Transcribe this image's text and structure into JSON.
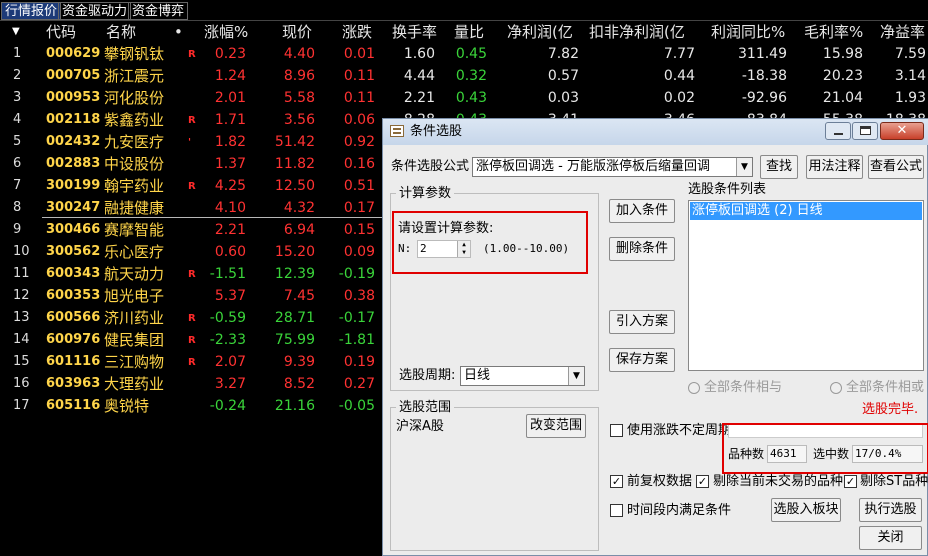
{
  "tabs": [
    "行情报价",
    "资金驱动力",
    "资金博弈"
  ],
  "table": {
    "headers": [
      "代码",
      "名称",
      "•",
      "涨幅%",
      "现价",
      "涨跌",
      "换手率",
      "量比",
      "净利润(亿",
      "扣非净利润(亿",
      "利润同比%",
      "毛利率%",
      "净益率"
    ],
    "rows": [
      {
        "i": "1",
        "code": "000629",
        "name": "攀钢钒钛",
        "r": "R",
        "pct": "0.23",
        "price": "4.40",
        "chg": "0.01",
        "turn": "1.60",
        "vr": "0.45",
        "np": "7.82",
        "knp": "7.77",
        "yoy": "311.49",
        "gm": "15.98",
        "roe": "7.59",
        "dir": "up",
        "vrc": "green"
      },
      {
        "i": "2",
        "code": "000705",
        "name": "浙江震元",
        "r": "",
        "pct": "1.24",
        "price": "8.96",
        "chg": "0.11",
        "turn": "4.44",
        "vr": "0.32",
        "np": "0.57",
        "knp": "0.44",
        "yoy": "-18.38",
        "gm": "20.23",
        "roe": "3.14",
        "dir": "up",
        "vrc": "green"
      },
      {
        "i": "3",
        "code": "000953",
        "name": "河化股份",
        "r": "",
        "pct": "2.01",
        "price": "5.58",
        "chg": "0.11",
        "turn": "2.21",
        "vr": "0.43",
        "np": "0.03",
        "knp": "0.02",
        "yoy": "-92.96",
        "gm": "21.04",
        "roe": "1.93",
        "dir": "up",
        "vrc": "green"
      },
      {
        "i": "4",
        "code": "002118",
        "name": "紫鑫药业",
        "r": "R",
        "pct": "1.71",
        "price": "3.56",
        "chg": "0.06",
        "turn": "",
        "vr": "",
        "np": "",
        "knp": "",
        "yoy": "",
        "gm": "",
        "roe": "",
        "dir": "up",
        "vrc": "green"
      },
      {
        "i": "5",
        "code": "002432",
        "name": "九安医疗",
        "r": "'",
        "pct": "1.82",
        "price": "51.42",
        "chg": "0.92",
        "turn": "",
        "vr": "",
        "np": "",
        "knp": "",
        "yoy": "",
        "gm": "",
        "roe": "",
        "dir": "up",
        "vrc": "green"
      },
      {
        "i": "6",
        "code": "002883",
        "name": "中设股份",
        "r": "",
        "pct": "1.37",
        "price": "11.82",
        "chg": "0.16",
        "turn": "",
        "vr": "",
        "np": "",
        "knp": "",
        "yoy": "",
        "gm": "",
        "roe": "",
        "dir": "up",
        "vrc": "green"
      },
      {
        "i": "7",
        "code": "300199",
        "name": "翰宇药业",
        "r": "R",
        "pct": "4.25",
        "price": "12.50",
        "chg": "0.51",
        "turn": "",
        "vr": "",
        "np": "",
        "knp": "",
        "yoy": "",
        "gm": "",
        "roe": "",
        "dir": "up",
        "vrc": "green"
      },
      {
        "i": "8",
        "code": "300247",
        "name": "融捷健康",
        "r": "",
        "pct": "4.10",
        "price": "4.32",
        "chg": "0.17",
        "turn": "",
        "vr": "",
        "np": "",
        "knp": "",
        "yoy": "",
        "gm": "",
        "roe": "",
        "dir": "up",
        "vrc": "green"
      },
      {
        "i": "9",
        "code": "300466",
        "name": "赛摩智能",
        "r": "",
        "pct": "2.21",
        "price": "6.94",
        "chg": "0.15",
        "turn": "",
        "vr": "",
        "np": "",
        "knp": "",
        "yoy": "",
        "gm": "",
        "roe": "",
        "dir": "up",
        "vrc": "green"
      },
      {
        "i": "10",
        "code": "300562",
        "name": "乐心医疗",
        "r": "",
        "pct": "0.60",
        "price": "15.20",
        "chg": "0.09",
        "turn": "",
        "vr": "",
        "np": "",
        "knp": "",
        "yoy": "",
        "gm": "",
        "roe": "",
        "dir": "up",
        "vrc": "green"
      },
      {
        "i": "11",
        "code": "600343",
        "name": "航天动力",
        "r": "R",
        "pct": "-1.51",
        "price": "12.39",
        "chg": "-0.19",
        "turn": "",
        "vr": "",
        "np": "",
        "knp": "",
        "yoy": "",
        "gm": "",
        "roe": "",
        "dir": "down",
        "vrc": "green"
      },
      {
        "i": "12",
        "code": "600353",
        "name": "旭光电子",
        "r": "",
        "pct": "5.37",
        "price": "7.45",
        "chg": "0.38",
        "turn": "",
        "vr": "",
        "np": "",
        "knp": "",
        "yoy": "",
        "gm": "",
        "roe": "",
        "dir": "up",
        "vrc": "green"
      },
      {
        "i": "13",
        "code": "600566",
        "name": "济川药业",
        "r": "R",
        "pct": "-0.59",
        "price": "28.71",
        "chg": "-0.17",
        "turn": "",
        "vr": "",
        "np": "",
        "knp": "",
        "yoy": "",
        "gm": "",
        "roe": "",
        "dir": "down",
        "vrc": "green"
      },
      {
        "i": "14",
        "code": "600976",
        "name": "健民集团",
        "r": "R",
        "pct": "-2.33",
        "price": "75.99",
        "chg": "-1.81",
        "turn": "",
        "vr": "",
        "np": "",
        "knp": "",
        "yoy": "",
        "gm": "",
        "roe": "",
        "dir": "down",
        "vrc": "green"
      },
      {
        "i": "15",
        "code": "601116",
        "name": "三江购物",
        "r": "R",
        "pct": "2.07",
        "price": "9.39",
        "chg": "0.19",
        "turn": "",
        "vr": "",
        "np": "",
        "knp": "",
        "yoy": "",
        "gm": "",
        "roe": "",
        "dir": "up",
        "vrc": "green"
      },
      {
        "i": "16",
        "code": "603963",
        "name": "大理药业",
        "r": "",
        "pct": "3.27",
        "price": "8.52",
        "chg": "0.27",
        "turn": "",
        "vr": "",
        "np": "",
        "knp": "",
        "yoy": "",
        "gm": "",
        "roe": "",
        "dir": "up",
        "vrc": "green"
      },
      {
        "i": "17",
        "code": "605116",
        "name": "奥锐特",
        "r": "",
        "pct": "-0.24",
        "price": "21.16",
        "chg": "-0.05",
        "turn": "",
        "vr": "",
        "np": "",
        "knp": "",
        "yoy": "",
        "gm": "",
        "roe": "",
        "dir": "down",
        "vrc": "green"
      }
    ],
    "partial_row4": {
      "turn": "8.28",
      "vr": "0.43",
      "np": "3.41",
      "knp": "3.46",
      "yoy": "-83.84",
      "gm": "55.38",
      "roe": "18.38"
    }
  },
  "dialog": {
    "title": "条件选股",
    "formula_label": "条件选股公式",
    "formula_value": "涨停板回调选 - 万能版涨停板后缩量回调",
    "btn_find": "查找",
    "btn_usage": "用法注释",
    "btn_view": "查看公式",
    "params_group": "计算参数",
    "params_prompt": "请设置计算参数:",
    "param_n_label": "N:",
    "param_n_value": "2",
    "param_range": "(1.00--10.00)",
    "period_label": "选股周期:",
    "period_value": "日线",
    "scope_group": "选股范围",
    "scope_value": "沪深A股",
    "btn_change_scope": "改变范围",
    "btn_add": "加入条件",
    "btn_delete": "删除条件",
    "btn_import": "引入方案",
    "btn_save": "保存方案",
    "cond_list_label": "选股条件列表",
    "cond_items": [
      "涨停板回调选 (2) 日线"
    ],
    "radio_and": "全部条件相与",
    "radio_or": "全部条件相或",
    "status": "选股完毕.",
    "use_uncertain_period": "使用涨跌不定周期",
    "total_label": "品种数",
    "total_value": "4631",
    "selected_label": "选中数",
    "selected_value": "17/0.4%",
    "cb_fq": "前复权数据",
    "cb_exclude_untraded": "剔除当前未交易的品种",
    "cb_exclude_st": "剔除ST品种",
    "cb_period_all": "时间段内满足条件",
    "btn_to_block": "选股入板块",
    "btn_execute": "执行选股",
    "btn_close": "关闭"
  }
}
